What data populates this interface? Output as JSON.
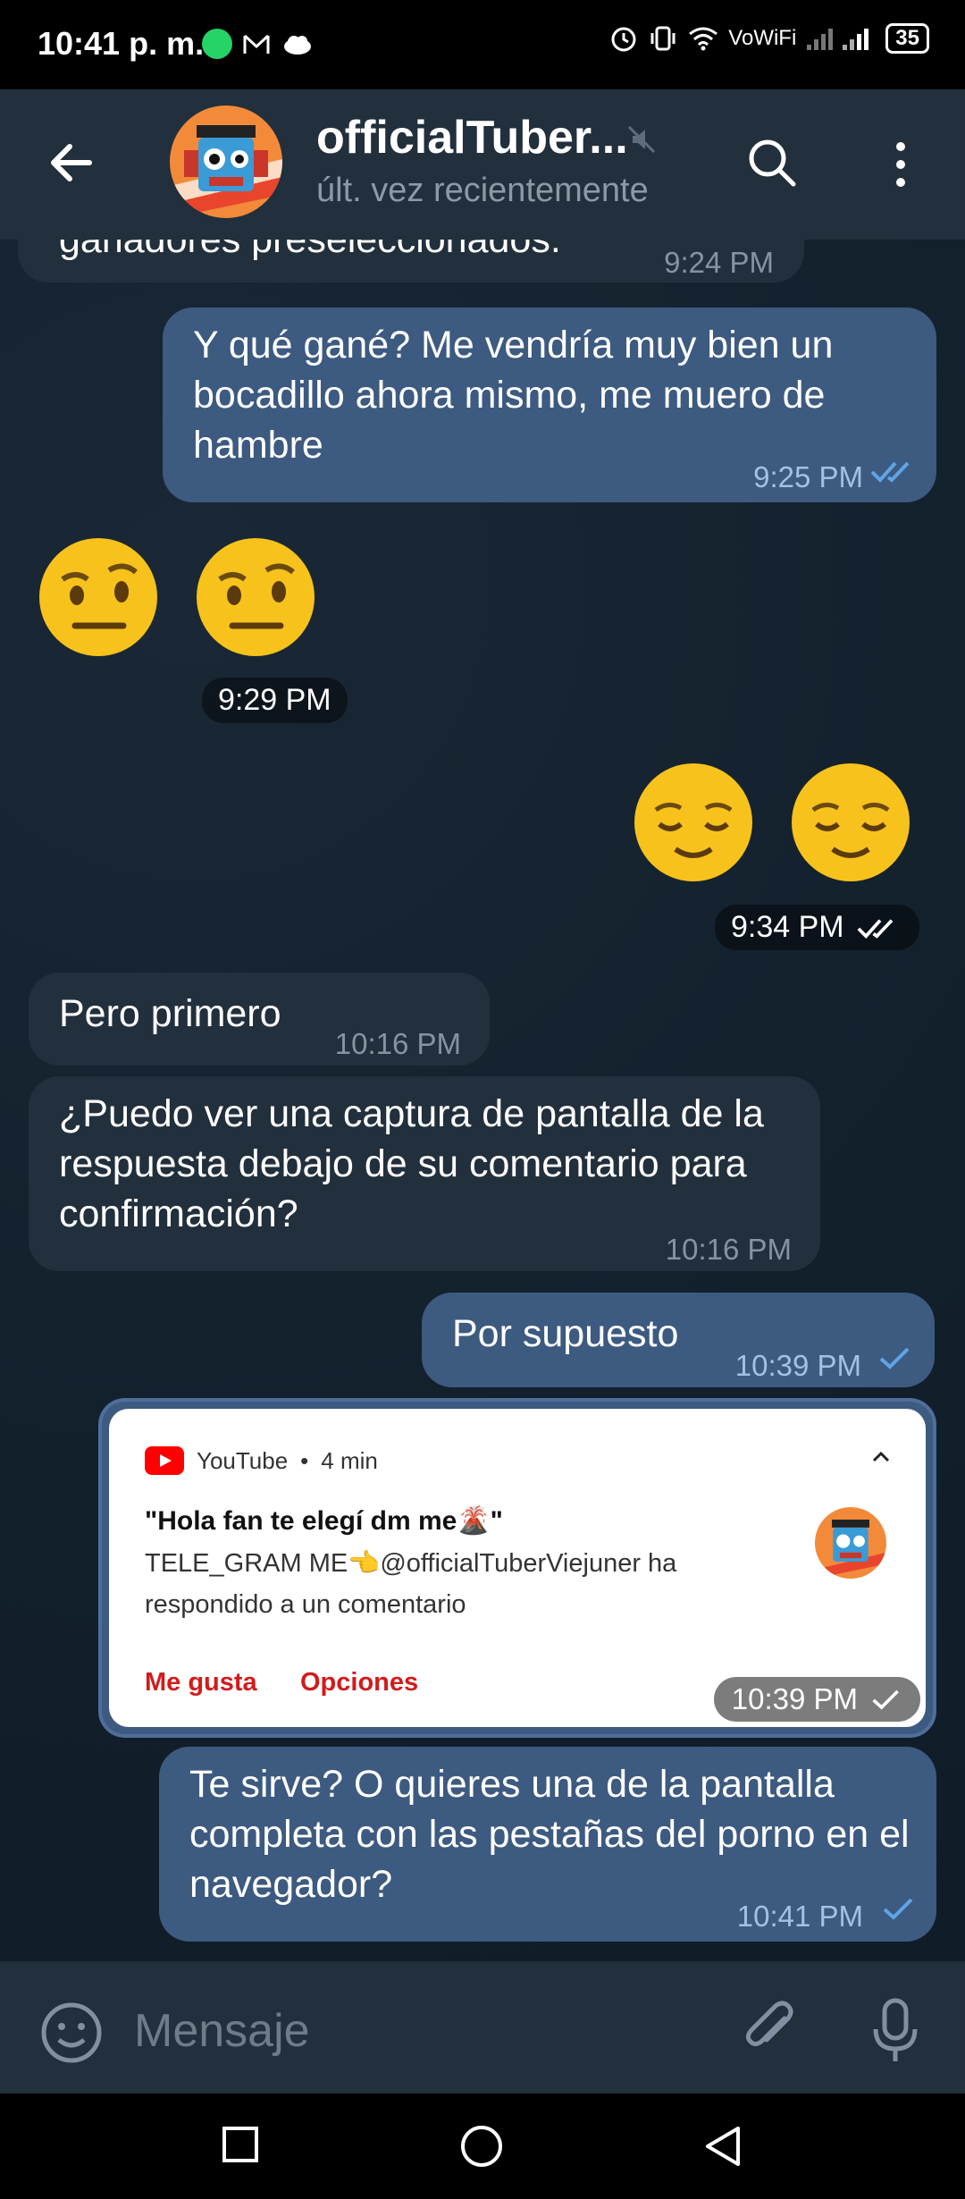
{
  "status_bar": {
    "time": "10:41 p. m.",
    "network_label": "VoWiFi",
    "battery": "35"
  },
  "header": {
    "title": "officialTuber...",
    "subtitle": "últ. vez recientemente"
  },
  "messages": [
    {
      "id": "m0",
      "direction": "in",
      "text": "ganadores preseleccionados.",
      "time": "9:24 PM"
    },
    {
      "id": "m1",
      "direction": "out",
      "text": "Y qué gané? Me vendría muy bien un bocadillo ahora mismo, me muero de hambre",
      "time": "9:25 PM",
      "status": "read"
    },
    {
      "id": "m2",
      "direction": "in",
      "type": "emoji",
      "text": "🤨🤨",
      "time": "9:29 PM"
    },
    {
      "id": "m3",
      "direction": "out",
      "type": "emoji",
      "text": "😌😌",
      "time": "9:34 PM",
      "status": "read"
    },
    {
      "id": "m4",
      "direction": "in",
      "text": "Pero primero",
      "time": "10:16 PM"
    },
    {
      "id": "m5",
      "direction": "in",
      "text": "¿Puedo ver una captura de pantalla de la respuesta debajo de su comentario para confirmación?",
      "time": "10:16 PM"
    },
    {
      "id": "m6",
      "direction": "out",
      "text": "Por supuesto",
      "time": "10:39 PM",
      "status": "sent"
    },
    {
      "id": "m7",
      "direction": "out",
      "type": "image",
      "time": "10:39 PM",
      "status": "sent",
      "notification": {
        "app": "YouTube",
        "age": "4 min",
        "title": "\"Hola fan te elegí dm me🌋\"",
        "body": "TELE_GRAM ME👈@officialTuberViejuner ha respondido a un comentario",
        "actions": [
          "Me gusta",
          "Opciones"
        ]
      }
    },
    {
      "id": "m8",
      "direction": "out",
      "text": "Te sirve? O quieres una de la pantalla completa con las pestañas del porno en el navegador?",
      "time": "10:41 PM",
      "status": "sent"
    }
  ],
  "input": {
    "placeholder": "Mensaje"
  },
  "colors": {
    "header_bg": "#222f3c",
    "incoming_bubble": "#222f3c",
    "outgoing_bubble": "#3d5a80",
    "accent_read": "#5fa4e6"
  },
  "icons": [
    "back-arrow-icon",
    "mute-icon",
    "search-icon",
    "more-vert-icon",
    "emoji-icon",
    "attach-icon",
    "mic-icon",
    "whatsapp-icon",
    "gmail-icon",
    "cloud-icon",
    "alarm-icon",
    "vibrate-icon",
    "wifi-icon",
    "signal-icon",
    "battery-icon",
    "youtube-icon",
    "nav-recents-icon",
    "nav-home-icon",
    "nav-back-icon"
  ]
}
